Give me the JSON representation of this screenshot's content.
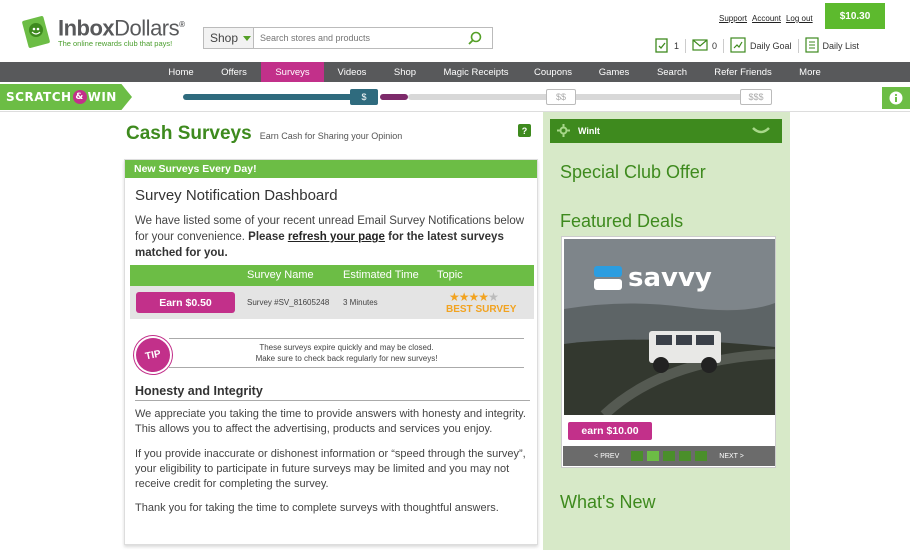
{
  "header": {
    "logo_name_bold": "Inbox",
    "logo_name_rest": "Dollars",
    "logo_mark": "®",
    "logo_tagline": "The online rewards club that pays!",
    "shop_label": "Shop",
    "search_placeholder": "Search stores and products",
    "links": [
      "Support",
      "Account",
      "Log out"
    ],
    "balance": "$10.30",
    "utility": {
      "tasks_count": "1",
      "mail_count": "0",
      "daily_goal": "Daily Goal",
      "daily_list": "Daily List"
    }
  },
  "nav": [
    "Home",
    "Offers",
    "Surveys",
    "Videos",
    "Shop",
    "Magic Receipts",
    "Coupons",
    "Games",
    "Search",
    "Refer Friends",
    "More"
  ],
  "nav_active": "Surveys",
  "scratch": {
    "logo_left": "SCRATCH",
    "logo_amp": "&",
    "logo_right": "WIN",
    "markers": [
      "$",
      "$$",
      "$$$"
    ],
    "info": "i"
  },
  "page": {
    "title": "Cash Surveys",
    "subtitle": "Earn Cash for Sharing your Opinion",
    "help": "?"
  },
  "card": {
    "header": "New Surveys Every Day!",
    "dashboard_title": "Survey Notification Dashboard",
    "intro_1": "We have listed some of your recent unread Email Survey Notifications below for your convenience. ",
    "intro_bold_1": "Please ",
    "intro_link": "refresh your page",
    "intro_bold_2": " for the latest surveys matched for you.",
    "columns": [
      "Survey Name",
      "Estimated Time",
      "Topic"
    ],
    "rows": [
      {
        "earn": "Earn $0.50",
        "name": "Survey #SV_81605248",
        "time": "3 Minutes",
        "topic": "BEST SURVEY",
        "stars": 4,
        "stars_max": 5
      }
    ],
    "tip_badge": "TIP",
    "tip_line_1": "These surveys expire quickly and may be closed.",
    "tip_line_2": "Make sure to check back regularly for new surveys!",
    "section_title": "Honesty and Integrity",
    "para_1": "We appreciate you taking the time to provide answers with honesty and integrity. This allows you to affect the advertising, products and services you enjoy.",
    "para_2": "If you provide inaccurate or dishonest information or “speed through the survey”, your eligibility to participate in future surveys may be limited and you may not receive credit for completing the survey.",
    "para_3": "Thank you for taking the time to complete surveys with thoughtful answers."
  },
  "sidebar": {
    "winit": "WinIt",
    "special_offer": "Special Club Offer",
    "featured": "Featured Deals",
    "deal_brand": "savvy",
    "deal_earn": "earn $10.00",
    "prev": "< PREV",
    "next": "NEXT >",
    "pages": 5,
    "active_page": 2,
    "whats_new": "What's New"
  },
  "colors": {
    "green": "#6cbd45",
    "dark_green": "#3e8a1e",
    "magenta": "#c2308a",
    "nav_gray": "#58595b",
    "panel_green": "#d7e9c8",
    "star_orange": "#f2a320"
  }
}
